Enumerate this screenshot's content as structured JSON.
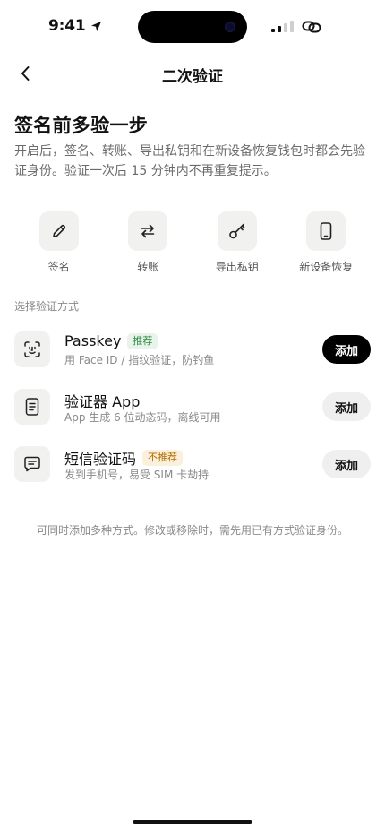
{
  "status_bar": {
    "time": "9:41",
    "location_icon": "location-arrow-icon",
    "signal_icon": "cellular-signal-icon",
    "link_icon": "link-icon"
  },
  "nav": {
    "back_icon": "chevron-left-icon",
    "title": "二次验证"
  },
  "header": {
    "title": "签名前多验一步",
    "description": "开启后，签名、转账、导出私钥和在新设备恢复钱包时都会先验证身份。验证一次后 15 分钟内不再重复提示。"
  },
  "features": [
    {
      "label": "签名",
      "icon": "pencil-icon"
    },
    {
      "label": "转账",
      "icon": "transfer-arrows-icon"
    },
    {
      "label": "导出私钥",
      "icon": "key-icon"
    },
    {
      "label": "新设备恢复",
      "icon": "phone-icon"
    }
  ],
  "section": {
    "label": "选择验证方式"
  },
  "methods": [
    {
      "title": "Passkey",
      "badge": "推荐",
      "subtitle": "用 Face ID / 指纹验证，防钓鱼",
      "button": "添加",
      "icon": "face-id-icon"
    },
    {
      "title": "验证器 App",
      "badge": "",
      "subtitle": "App 生成 6 位动态码，离线可用",
      "button": "添加",
      "icon": "authenticator-icon"
    },
    {
      "title": "短信验证码",
      "badge": "不推荐",
      "subtitle": "发到手机号，易受 SIM 卡劫持",
      "button": "添加",
      "icon": "message-icon"
    }
  ],
  "footnote": "可同时添加多种方式。修改或移除时，需先用已有方式验证身份。",
  "colors": {
    "primary_button": "#000000",
    "recommend_badge": "#2e8a45",
    "warn_badge": "#b36b00",
    "icon_tile": "#f1f2f0"
  }
}
